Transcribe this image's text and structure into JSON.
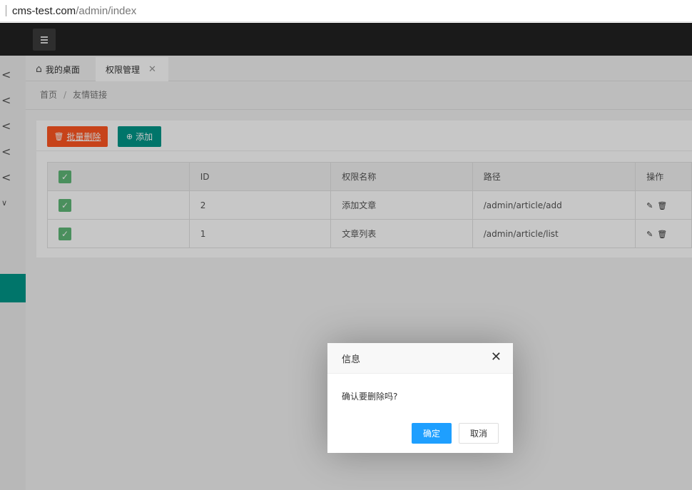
{
  "address_bar": {
    "host": "cms-test.com",
    "path": "/admin/index"
  },
  "sidebar": {
    "arrows": [
      "<",
      "<",
      "<",
      "<",
      "<",
      "∨"
    ]
  },
  "tabs": {
    "home_label": "我的桌面",
    "active_label": "权限管理"
  },
  "breadcrumb": {
    "home": "首页",
    "separator": "/",
    "current": "友情链接"
  },
  "toolbar": {
    "batch_delete_label": "批量删除",
    "add_label": "添加"
  },
  "table": {
    "headers": {
      "check": "",
      "id": "ID",
      "name": "权限名称",
      "path": "路径",
      "action": "操作"
    },
    "rows": [
      {
        "id": "2",
        "name": "添加文章",
        "path": "/admin/article/add"
      },
      {
        "id": "1",
        "name": "文章列表",
        "path": "/admin/article/list"
      }
    ]
  },
  "dialog": {
    "title": "信息",
    "message": "确认要删除吗?",
    "ok_label": "确定",
    "cancel_label": "取消"
  },
  "colors": {
    "accent": "#009688",
    "danger": "#ff5722",
    "primary": "#1E9FFF",
    "check": "#5FB878",
    "header": "#222222"
  }
}
